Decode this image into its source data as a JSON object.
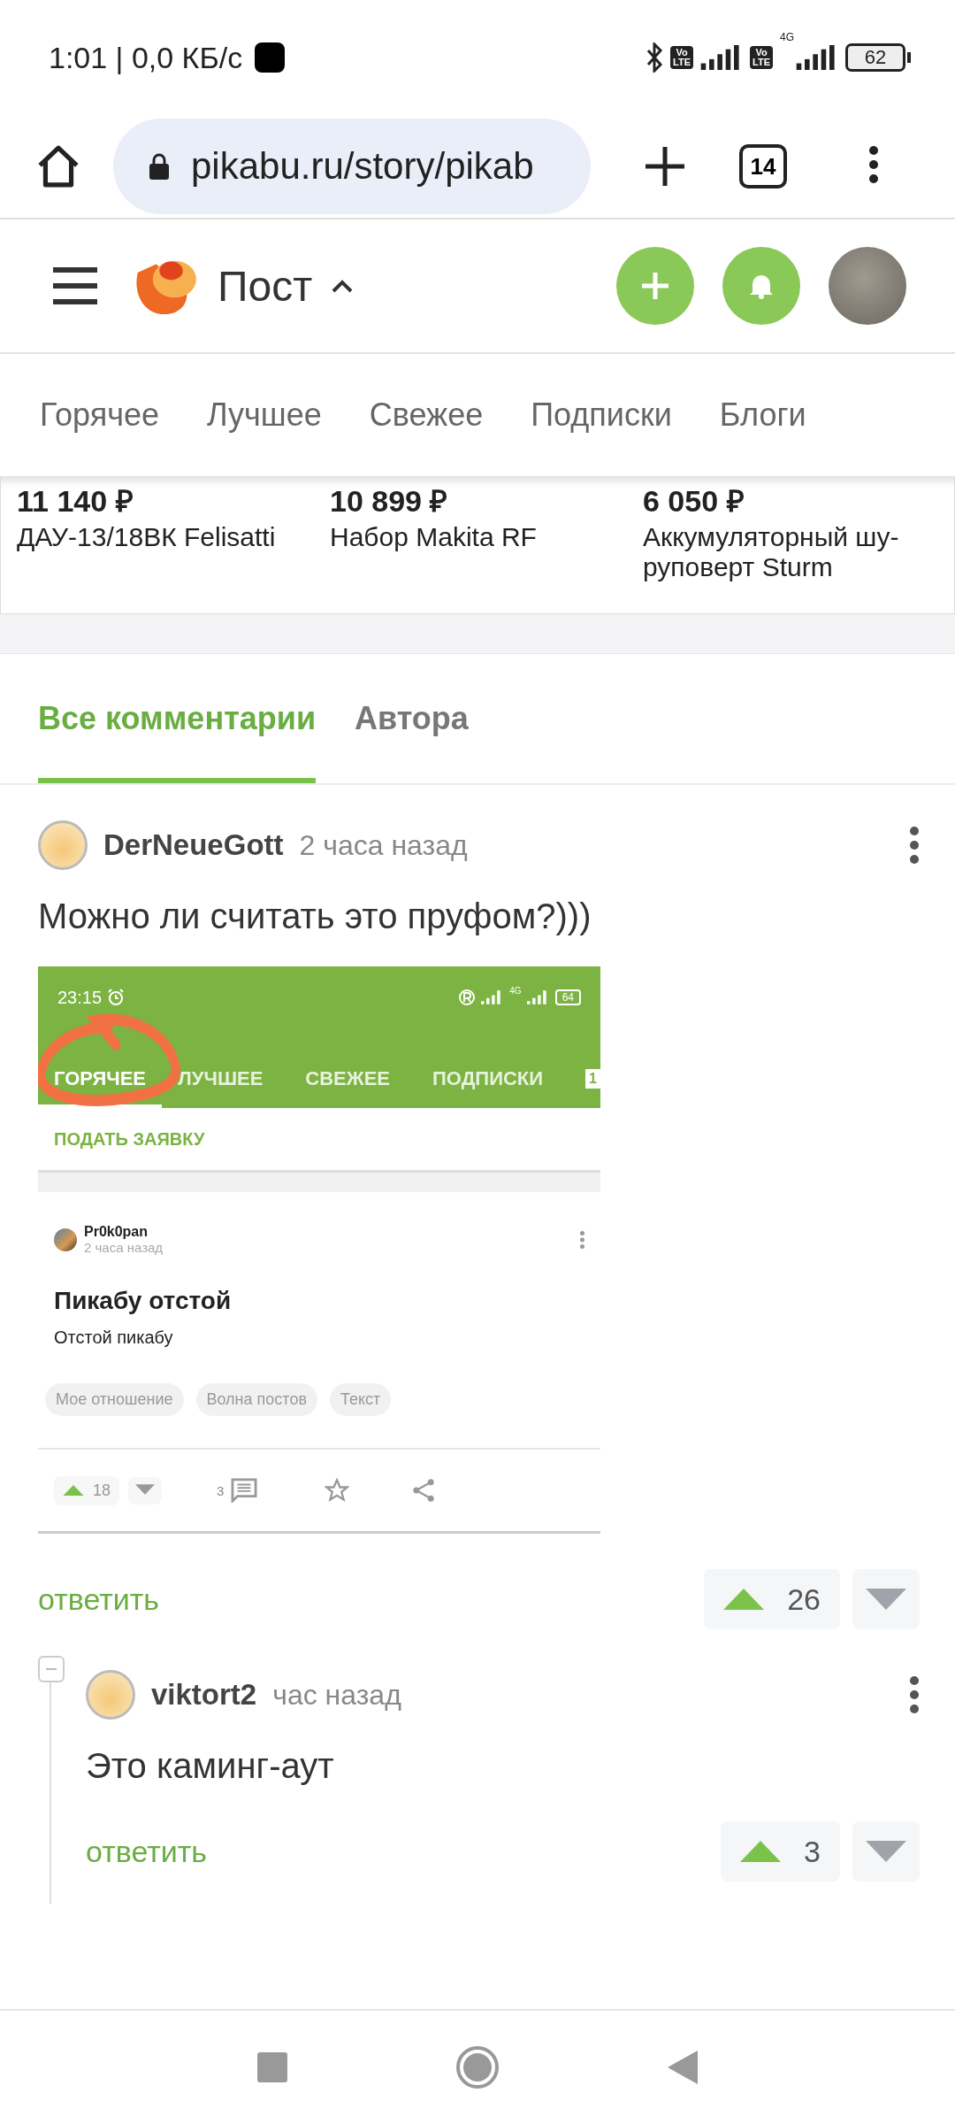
{
  "status_bar": {
    "time": "1:01 | 0,0 КБ/с",
    "sim_badges": [
      {
        "top": "Vo",
        "bottom": "LTE"
      },
      {
        "top": "Vo",
        "bottom": "LTE"
      }
    ],
    "network_type": "4G",
    "battery": "62"
  },
  "browser": {
    "url": "pikabu.ru/story/pikab",
    "tab_count": "14"
  },
  "header": {
    "title": "Пост"
  },
  "nav": {
    "items": [
      {
        "label": "Горячее",
        "selected": false
      },
      {
        "label": "Лучшее",
        "selected": false
      },
      {
        "label": "Свежее",
        "selected": false
      },
      {
        "label": "Подписки",
        "selected": false
      },
      {
        "label": "Блоги",
        "selected": false
      }
    ]
  },
  "products": [
    {
      "price": "11 140 ₽",
      "name": "ДАУ-13/18ВК Felisatti"
    },
    {
      "price": "10 899 ₽",
      "name": "Набор Makita RF"
    },
    {
      "price": "6 050 ₽",
      "name": "Аккумуляторный шу-руповерт Sturm"
    }
  ],
  "comment_tabs": [
    {
      "label": "Все комментарии",
      "selected": true
    },
    {
      "label": "Автора",
      "selected": false
    }
  ],
  "comments": [
    {
      "author": "DerNeueGott",
      "time": "2 часа назад",
      "text": "Можно ли считать это пруфом?)))",
      "embedded_screenshot": {
        "status_time": "23:15",
        "battery": "64",
        "network_type": "4G",
        "tabs": [
          {
            "label": "ГОРЯЧЕЕ",
            "selected": true
          },
          {
            "label": "ЛУЧШЕЕ",
            "selected": false
          },
          {
            "label": "СВЕЖЕЕ",
            "selected": false
          },
          {
            "label": "ПОДПИСКИ",
            "selected": false
          }
        ],
        "tab_badge": "1",
        "action": "ПОДАТЬ ЗАЯВКУ",
        "post": {
          "author": "Pr0k0pan",
          "time": "2 часа назад",
          "title": "Пикабу отстой",
          "text": "Отстой пикабу",
          "tags": [
            "Мое отношение",
            "Волна постов",
            "Текст"
          ],
          "votes": "18",
          "comments": "3"
        }
      },
      "reply": "ответить",
      "votes": "26",
      "expanded": true,
      "replies": [
        {
          "author": "viktort2",
          "time": "час назад",
          "text": "Это каминг-аут",
          "reply": "ответить",
          "votes": "3"
        }
      ]
    }
  ]
}
